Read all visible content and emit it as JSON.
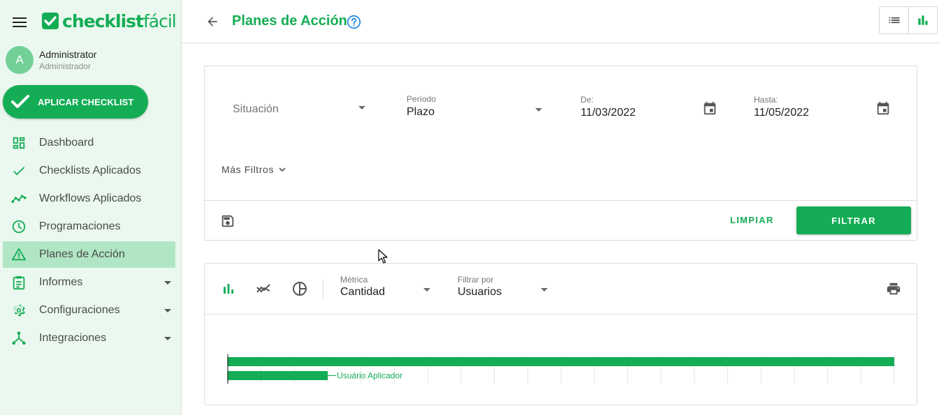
{
  "brand": {
    "name_bold": "checklist",
    "name_light": "fácil",
    "accent": "#14ad55",
    "active_bg": "#b0e6c4",
    "sidebar_bg": "#ebf8ef"
  },
  "user": {
    "initial": "A",
    "name": "Administrator",
    "role": "Administrador"
  },
  "apply_button": {
    "label": "APLICAR CHECKLIST",
    "icon": "check-icon"
  },
  "nav": [
    {
      "label": "Dashboard",
      "icon": "dashboard-icon",
      "active": false,
      "expandable": false
    },
    {
      "label": "Checklists Aplicados",
      "icon": "check-icon",
      "active": false,
      "expandable": false
    },
    {
      "label": "Workflows Aplicados",
      "icon": "timeline-icon",
      "active": false,
      "expandable": false
    },
    {
      "label": "Programaciones",
      "icon": "clock-icon",
      "active": false,
      "expandable": false
    },
    {
      "label": "Planes de Acción",
      "icon": "warning-icon",
      "active": true,
      "expandable": false
    },
    {
      "label": "Informes",
      "icon": "clipboard-icon",
      "active": false,
      "expandable": true
    },
    {
      "label": "Configuraciones",
      "icon": "gear-icon",
      "active": false,
      "expandable": true
    },
    {
      "label": "Integraciones",
      "icon": "hub-icon",
      "active": false,
      "expandable": true
    }
  ],
  "header": {
    "title": "Planes de Acción",
    "help_icon": "help-circle-icon",
    "views": [
      "list-view-icon",
      "chart-view-icon"
    ]
  },
  "filters": {
    "situacion": {
      "placeholder": "Situación"
    },
    "periodo": {
      "label": "Período",
      "value": "Plazo"
    },
    "de": {
      "label": "De:",
      "value": "11/03/2022"
    },
    "hasta": {
      "label": "Hasta:",
      "value": "11/05/2022"
    },
    "more_filters": "Más Filtros",
    "clear_label": "LIMPIAR",
    "filter_label": "FILTRAR"
  },
  "chart_controls": {
    "metric": {
      "label": "Métrica",
      "value": "Cantidad"
    },
    "filter_by": {
      "label": "Filtrar por",
      "value": "Usuarios"
    }
  },
  "chart_data": {
    "type": "bar",
    "orientation": "horizontal",
    "categories": [
      "",
      ""
    ],
    "values": [
      100,
      15
    ],
    "annotations": [
      "",
      "Usuário Aplicador"
    ],
    "bar_color": "#14ad55",
    "xlim": [
      0,
      100
    ],
    "grid": true
  }
}
